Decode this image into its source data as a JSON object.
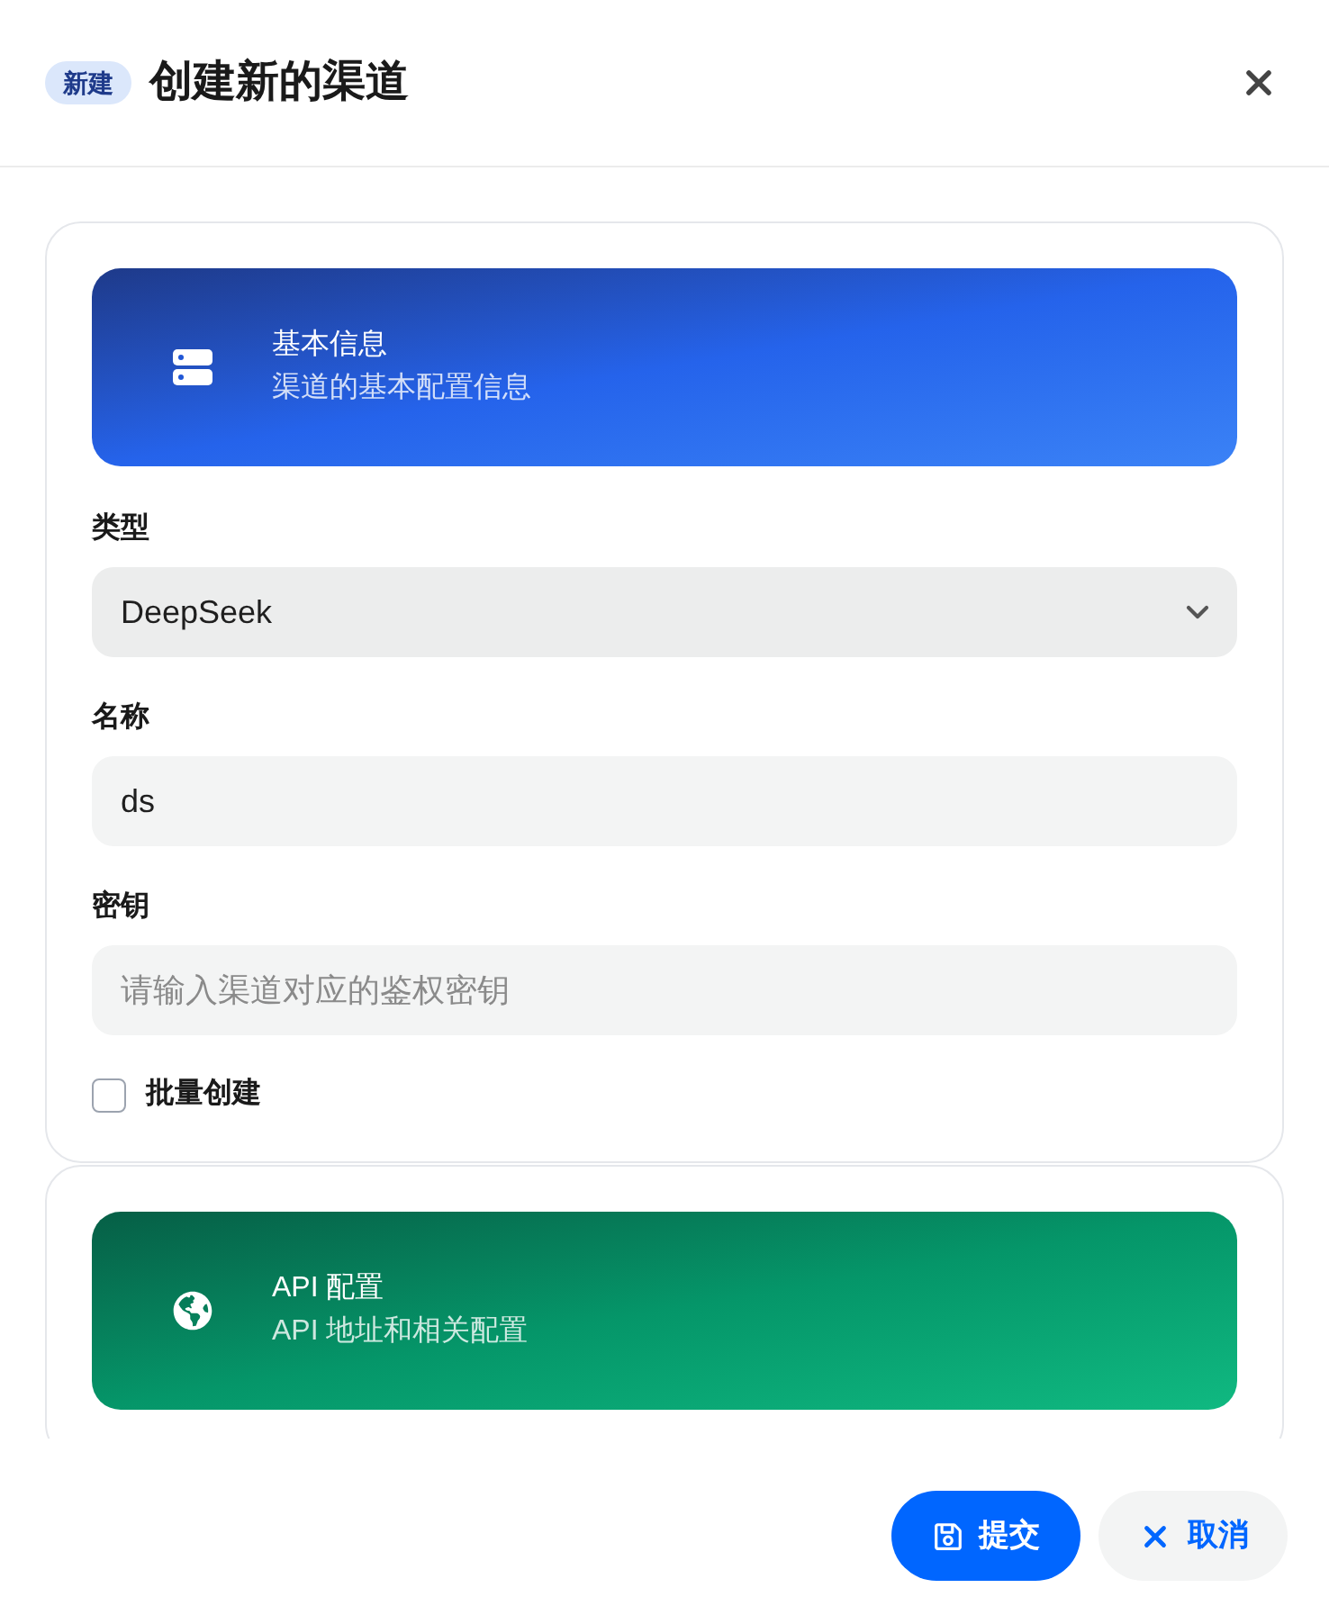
{
  "header": {
    "badge": "新建",
    "title": "创建新的渠道"
  },
  "sections": [
    {
      "kind": "basic",
      "title": "基本信息",
      "subtitle": "渠道的基本配置信息",
      "fields": [
        {
          "kind": "select",
          "label": "类型",
          "value": "DeepSeek"
        },
        {
          "kind": "text",
          "label": "名称",
          "value": "ds"
        },
        {
          "kind": "text",
          "label": "密钥",
          "placeholder": "请输入渠道对应的鉴权密钥"
        }
      ],
      "checkbox": {
        "label": "批量创建",
        "checked": false
      }
    },
    {
      "kind": "api",
      "title": "API 配置",
      "subtitle": "API 地址和相关配置"
    }
  ],
  "footer": {
    "buttons": [
      {
        "kind": "primary",
        "label": "提交"
      },
      {
        "kind": "secondary",
        "label": "取消"
      }
    ]
  }
}
